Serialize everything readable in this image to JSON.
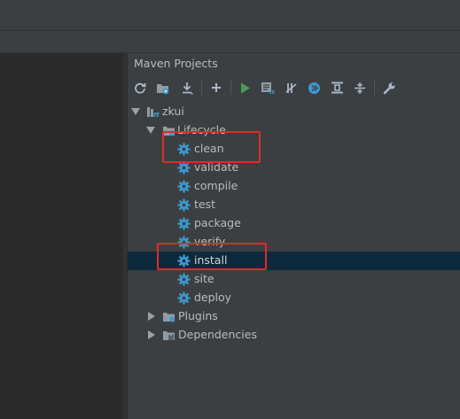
{
  "panel": {
    "title": "Maven Projects"
  },
  "toolbar": {
    "buttons": [
      {
        "icon": "refresh-icon"
      },
      {
        "icon": "generate-sources-icon"
      },
      {
        "icon": "download-icon"
      },
      {
        "icon": "add-icon"
      },
      {
        "icon": "run-icon"
      },
      {
        "icon": "execute-goal-icon"
      },
      {
        "icon": "toggle-offline-icon"
      },
      {
        "icon": "skip-tests-icon"
      },
      {
        "icon": "show-dependencies-icon"
      },
      {
        "icon": "collapse-all-icon"
      },
      {
        "icon": "settings-wrench-icon"
      }
    ]
  },
  "tree": {
    "project": "zkui",
    "lifecycle": {
      "label": "Lifecycle",
      "goals": [
        "clean",
        "validate",
        "compile",
        "test",
        "package",
        "verify",
        "install",
        "site",
        "deploy"
      ]
    },
    "plugins": "Plugins",
    "dependencies": "Dependencies",
    "selected": "install",
    "highlighted": [
      "clean",
      "install"
    ]
  },
  "colors": {
    "panel_bg": "#3c3f41",
    "selection": "#0d293e",
    "highlight_box": "#e02a2a",
    "gear": "#3d9ad1",
    "text": "#bbbbbb"
  }
}
